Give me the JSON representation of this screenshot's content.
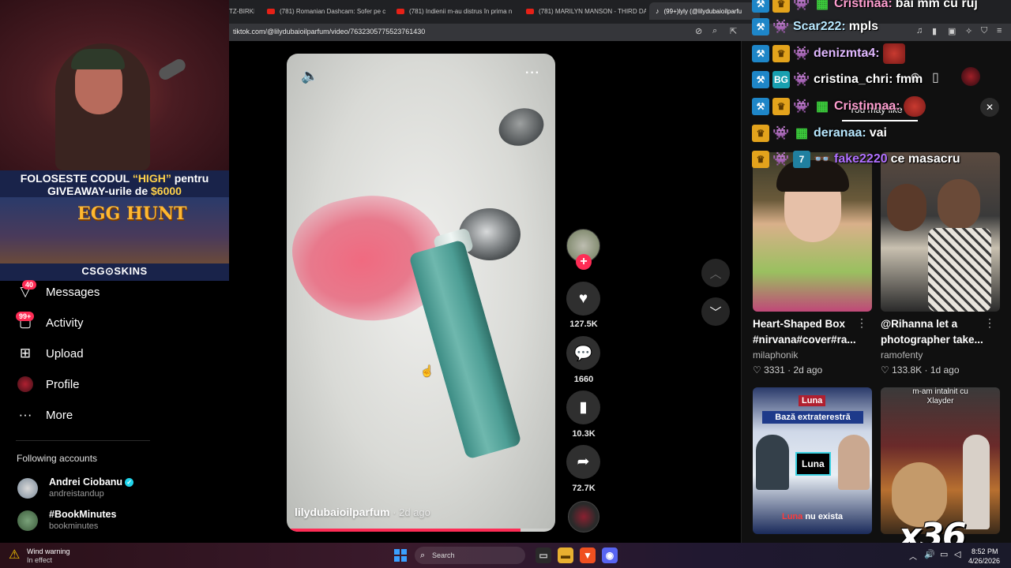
{
  "browser": {
    "tabs": [
      {
        "title": "TZ-BIRKE",
        "icon": "tab-favicon"
      },
      {
        "title": "(781) Romanian Dashcam: Sofer pe c",
        "icon": "youtube-icon"
      },
      {
        "title": "(781) Indienii m-au distrus în prima n",
        "icon": "youtube-icon"
      },
      {
        "title": "(781) MARILYN MANSON - THIRD DA",
        "icon": "youtube-icon"
      },
      {
        "title": "(99+)lyly (@lilydubaioilparfu",
        "icon": "tiktok-icon"
      }
    ],
    "url": "tiktok.com/@lilydubaioilparfum/video/7632305775523761430"
  },
  "stream_overlay": {
    "promo_line1_pre": "FOLOSESTE CODUL ",
    "promo_code": "“HIGH”",
    "promo_line1_post": " pentru",
    "promo_line2_pre": "GIVEAWAY-urile de ",
    "promo_amount": "$6000",
    "promo_event": "EGG HUNT",
    "promo_brand": "CSG⊙SKINS",
    "multiplier": "x36"
  },
  "sidebar": {
    "items": [
      {
        "label": "Messages",
        "icon": "messages-icon",
        "badge": "40"
      },
      {
        "label": "Activity",
        "icon": "activity-icon",
        "badge": "99+"
      },
      {
        "label": "Upload",
        "icon": "upload-icon"
      },
      {
        "label": "Profile",
        "icon": "profile-avatar"
      },
      {
        "label": "More",
        "icon": "more-icon"
      }
    ],
    "following_header": "Following accounts",
    "following": [
      {
        "name": "Andrei Ciobanu",
        "handle": "andreistandup",
        "verified": true
      },
      {
        "name": "#BookMinutes",
        "handle": "bookminutes",
        "verified": false
      }
    ]
  },
  "video": {
    "author": "lilydubaioilparfum",
    "age": " · 2d ago",
    "progress": 0.87,
    "actions": {
      "likes": "127.5K",
      "comments": "1660",
      "saves": "10.3K",
      "shares": "72.7K"
    }
  },
  "right_panel": {
    "tab_label": "You may like",
    "cards": [
      {
        "title": "Heart-Shaped Box #nirvana#cover#ra...",
        "author": "milaphonik",
        "likes": "3331",
        "age": "2d ago"
      },
      {
        "title": "@Rihanna let a photographer take...",
        "author": "ramofenty",
        "likes": "133.8K",
        "age": "1d ago"
      }
    ],
    "thumb3": {
      "top_label": "Luna",
      "headline": "Bază extraterestră",
      "center_label": "Luna",
      "bottom_word1": "Luna",
      "bottom_word2": " nu exista"
    },
    "thumb4": {
      "caption_line1": "m-am intalnit cu",
      "caption_line2": "Xlayder"
    }
  },
  "chat": [
    {
      "user": "Cristinaa:",
      "msg": "bai mm cu ruj"
    },
    {
      "user": "Scar222:",
      "msg": "mpls"
    },
    {
      "user": "denizmta4:",
      "msg": ""
    },
    {
      "user": "cristina_chri:",
      "msg": "fmm"
    },
    {
      "user": "Cristinnaa:",
      "msg": ""
    },
    {
      "user": "deranaa:",
      "msg": "vai"
    },
    {
      "user": "fake2220",
      "msg": "ce masacru"
    }
  ],
  "taskbar": {
    "weather_title": "Wind warning",
    "weather_sub": "In effect",
    "search_placeholder": "Search",
    "time": "8:52 PM",
    "date": "4/26/2026"
  },
  "colors": {
    "tiktok_red": "#fe2c55",
    "brand_teal": "#20d5ec",
    "promo_yellow": "#ffd24a"
  }
}
